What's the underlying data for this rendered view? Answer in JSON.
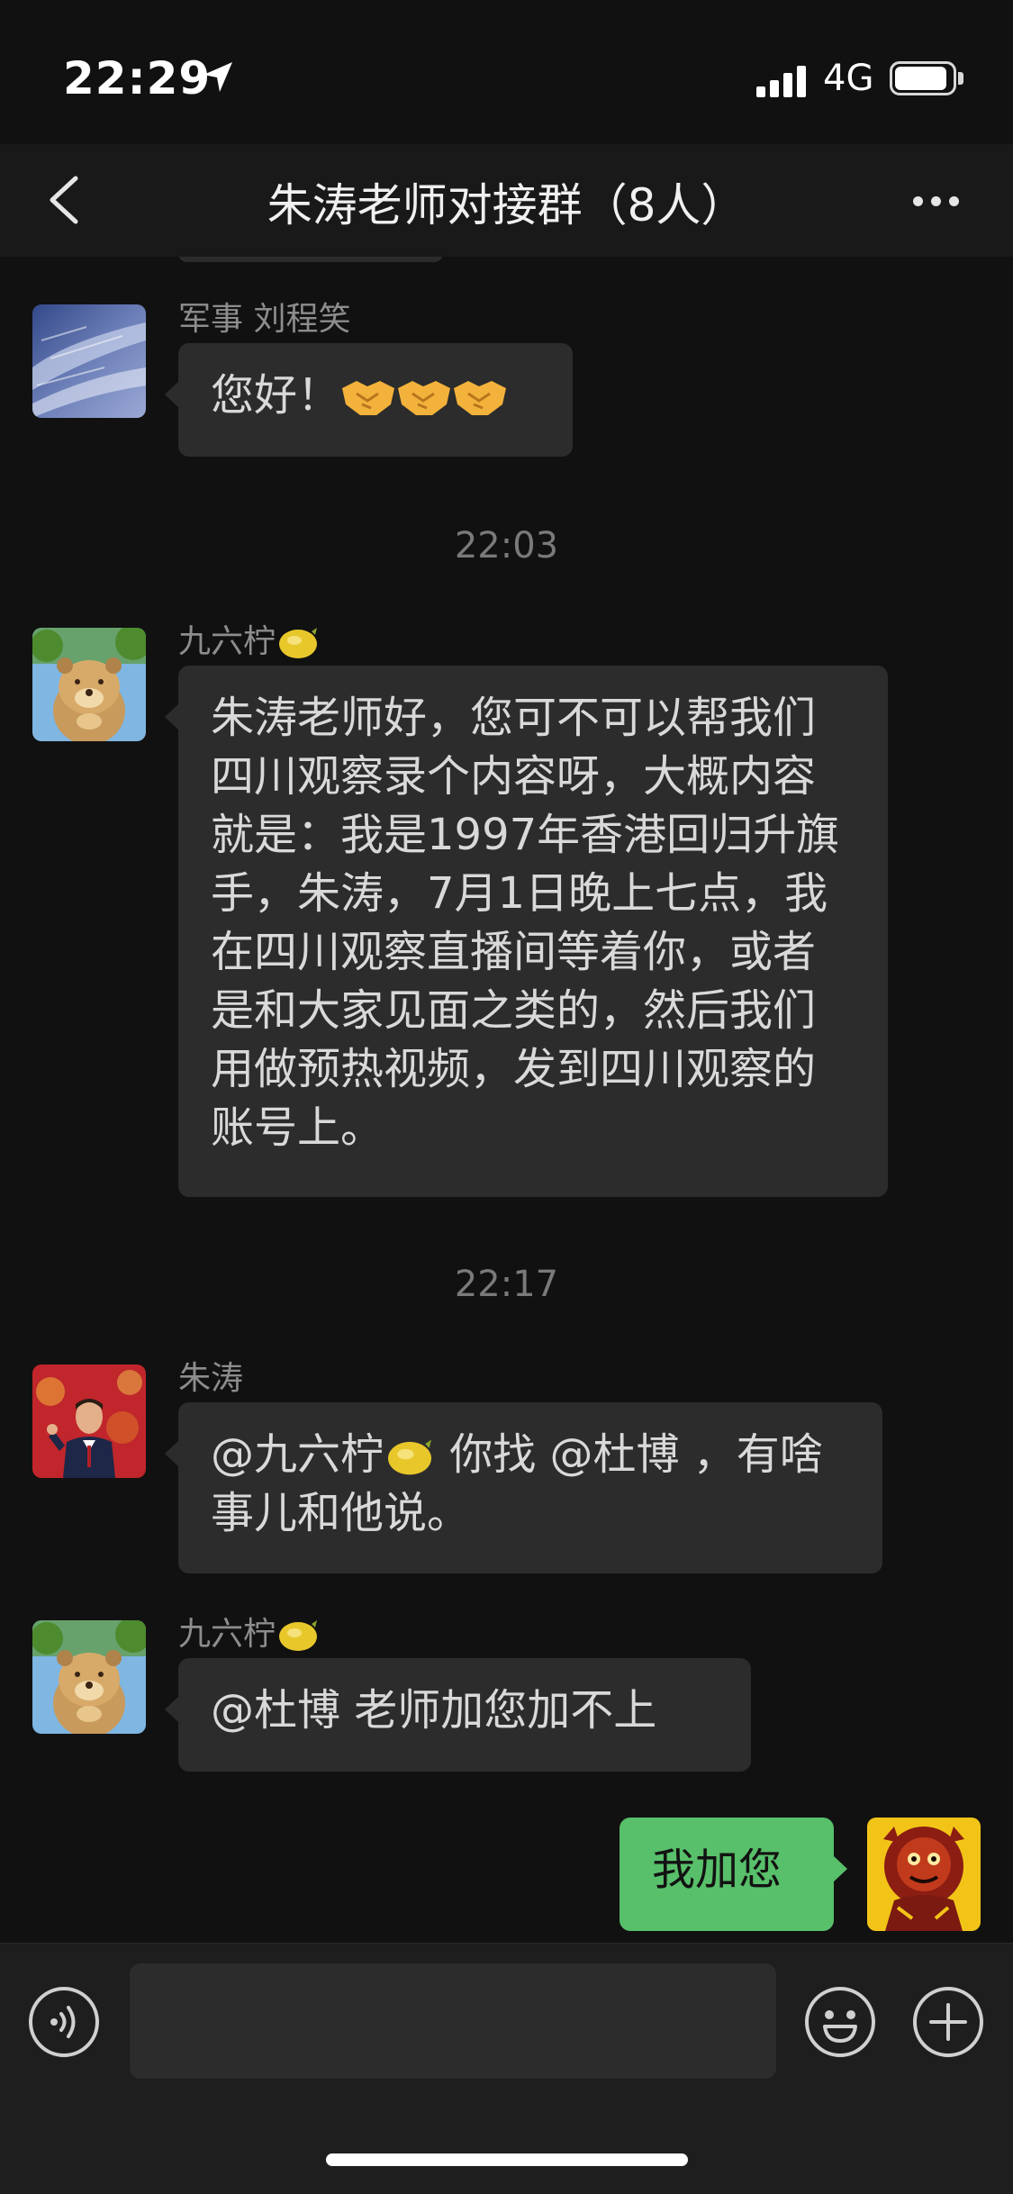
{
  "status_bar": {
    "time": "22:29",
    "network": "4G",
    "battery_level": 0.92,
    "signal_bars": 4
  },
  "nav": {
    "title": "朱涛老师对接群（8人）",
    "back_icon": "chevron-left-icon",
    "more_icon": "more-dots-icon"
  },
  "messages": {
    "m1": {
      "sender": "军事 刘程笑",
      "text": "您好！",
      "handshake_count": 3
    },
    "time1": "22:03",
    "m2": {
      "sender": "九六柠",
      "text": "朱涛老师好，您可不可以帮我们四川观察录个内容呀，大概内容就是：我是1997年香港回归升旗手，朱涛，7月1日晚上七点，我在四川观察直播间等着你，或者是和大家见面之类的，然后我们用做预热视频，发到四川观察的账号上。"
    },
    "time2": "22:17",
    "m3": {
      "sender": "朱涛",
      "mention1": "@九六柠",
      "text_rest": " 你找 @杜博 ，有啥事儿和他说。"
    },
    "m4": {
      "sender": "九六柠",
      "text": "@杜博 老师加您加不上"
    },
    "m5": {
      "text": "我加您"
    }
  },
  "input": {
    "value": "",
    "placeholder": ""
  },
  "colors": {
    "background": "#111111",
    "bubble_other": "#2c2c2c",
    "bubble_mine": "#58bf6a",
    "nav_background": "#191919"
  }
}
